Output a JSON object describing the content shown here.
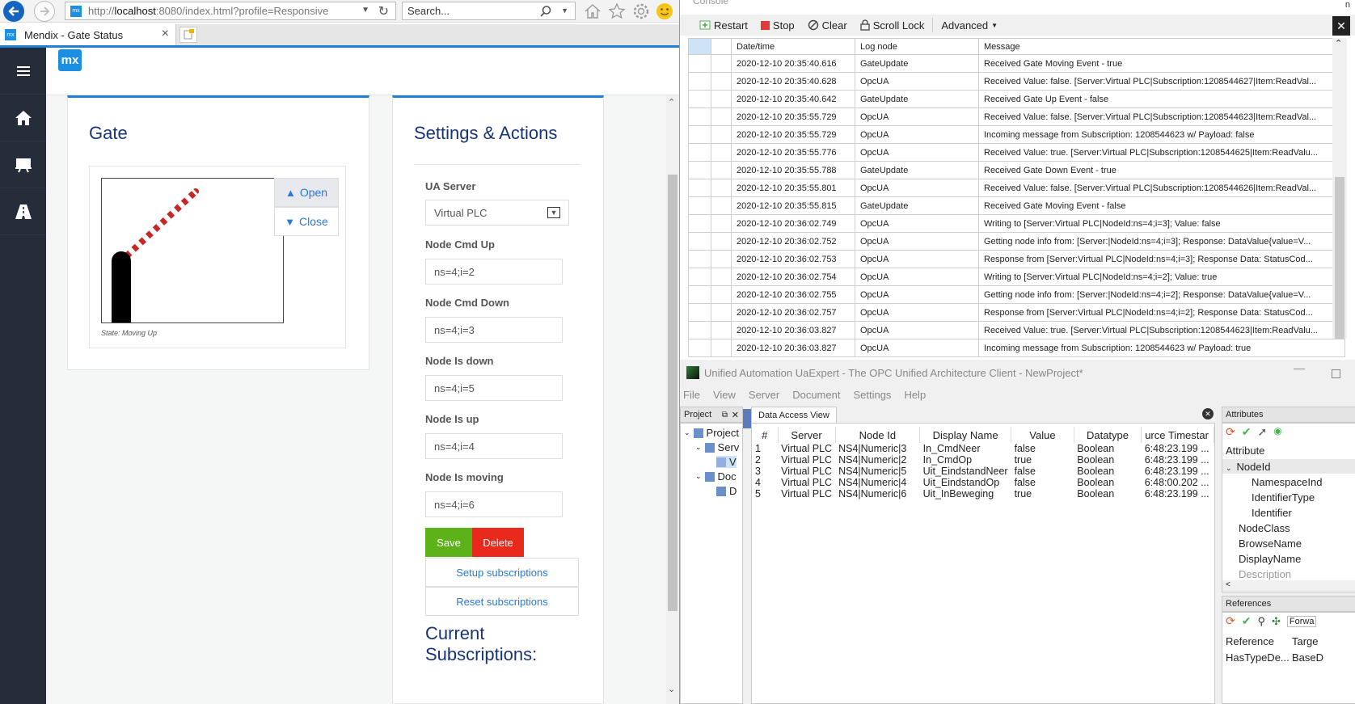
{
  "browser": {
    "url_prefix": "http://",
    "url_host": "localhost",
    "url_rest": ":8080/index.html?profile=Responsive",
    "search_placeholder": "Search...",
    "tab_title": "Mendix - Gate Status"
  },
  "mendix": {
    "logo": "mx",
    "gate_card": {
      "title": "Gate",
      "open_label": "Open",
      "close_label": "Close",
      "state_text": "State: Moving Up"
    },
    "settings_card": {
      "title": "Settings & Actions",
      "ua_server_label": "UA Server",
      "ua_server_value": "Virtual PLC",
      "fields": [
        {
          "label": "Node Cmd Up",
          "value": "ns=4;i=2"
        },
        {
          "label": "Node Cmd Down",
          "value": "ns=4;i=3"
        },
        {
          "label": "Node Is down",
          "value": "ns=4;i=5"
        },
        {
          "label": "Node Is up",
          "value": "ns=4;i=4"
        },
        {
          "label": "Node Is moving",
          "value": "ns=4;i=6"
        }
      ],
      "save_label": "Save",
      "delete_label": "Delete",
      "setup_label": "Setup subscriptions",
      "reset_label": "Reset subscriptions",
      "current_title_1": "Current",
      "current_title_2": "Subscriptions:"
    },
    "colors": {
      "sidebar": "#252c3a",
      "accent": "#1f7fd1",
      "save": "#5cb218",
      "delete": "#e8291c"
    }
  },
  "console": {
    "title": "Console",
    "toolbar": {
      "restart": "Restart",
      "stop": "Stop",
      "clear": "Clear",
      "scroll_lock": "Scroll Lock",
      "advanced": "Advanced"
    },
    "columns": [
      "Date/time",
      "Log node",
      "Message"
    ],
    "rows": [
      [
        "2020-12-10 20:35:40.616",
        "GateUpdate",
        "Received Gate Moving Event - true"
      ],
      [
        "2020-12-10 20:35:40.628",
        "OpcUA",
        "Received Value: false. [Server:Virtual PLC|Subscription:1208544627|Item:ReadVal..."
      ],
      [
        "2020-12-10 20:35:40.642",
        "GateUpdate",
        "Received Gate Up Event - false"
      ],
      [
        "2020-12-10 20:35:55.729",
        "OpcUA",
        "Received Value: false. [Server:Virtual PLC|Subscription:1208544623|Item:ReadVal..."
      ],
      [
        "2020-12-10 20:35:55.729",
        "OpcUA",
        "Incoming message from Subscription: 1208544623 w/ Payload: false"
      ],
      [
        "2020-12-10 20:35:55.776",
        "OpcUA",
        "Received Value: true. [Server:Virtual PLC|Subscription:1208544625|Item:ReadValu..."
      ],
      [
        "2020-12-10 20:35:55.788",
        "GateUpdate",
        "Received Gate Down Event - true"
      ],
      [
        "2020-12-10 20:35:55.801",
        "OpcUA",
        "Received Value: false. [Server:Virtual PLC|Subscription:1208544626|Item:ReadVal..."
      ],
      [
        "2020-12-10 20:35:55.815",
        "GateUpdate",
        "Received Gate Moving Event - false"
      ],
      [
        "2020-12-10 20:36:02.749",
        "OpcUA",
        "Writing to [Server:Virtual PLC|NodeId:ns=4;i=3]; Value: false"
      ],
      [
        "2020-12-10 20:36:02.752",
        "OpcUA",
        "Getting node info from: [Server:|NodeId:ns=4;i=3]; Response: DataValue{value=V..."
      ],
      [
        "2020-12-10 20:36:02.753",
        "OpcUA",
        "Response from [Server:Virtual PLC|NodeId:ns=4;i=3]; Response Data: StatusCod..."
      ],
      [
        "2020-12-10 20:36:02.754",
        "OpcUA",
        "Writing to [Server:Virtual PLC|NodeId:ns=4;i=2]; Value: true"
      ],
      [
        "2020-12-10 20:36:02.755",
        "OpcUA",
        "Getting node info from: [Server:|NodeId:ns=4;i=2]; Response: DataValue{value=V..."
      ],
      [
        "2020-12-10 20:36:02.757",
        "OpcUA",
        "Response from [Server:Virtual PLC|NodeId:ns=4;i=2]; Response Data: StatusCod..."
      ],
      [
        "2020-12-10 20:36:03.827",
        "OpcUA",
        "Received Value: true. [Server:Virtual PLC|Subscription:1208544623|Item:ReadValu..."
      ],
      [
        "2020-12-10 20:36:03.827",
        "OpcUA",
        "Incoming message from Subscription: 1208544623 w/ Payload: true"
      ]
    ]
  },
  "uaexpert": {
    "title": "Unified Automation UaExpert - The OPC Unified Architecture Client - NewProject*",
    "menu": [
      "File",
      "View",
      "Server",
      "Document",
      "Settings",
      "Help"
    ],
    "project_panel": {
      "title": "Project",
      "tree": [
        "Project",
        "Serv",
        "V",
        "Doc",
        "D"
      ]
    },
    "dav": {
      "tab": "Data Access View",
      "columns": [
        "#",
        "Server",
        "Node Id",
        "Display Name",
        "Value",
        "Datatype",
        "urce Timestar"
      ],
      "rows": [
        [
          "1",
          "Virtual PLC",
          "NS4|Numeric|3",
          "In_CmdNeer",
          "false",
          "Boolean",
          "6:48:23.199 ..."
        ],
        [
          "2",
          "Virtual PLC",
          "NS4|Numeric|2",
          "In_CmdOp",
          "true",
          "Boolean",
          "6:48:23.199 ..."
        ],
        [
          "3",
          "Virtual PLC",
          "NS4|Numeric|5",
          "Uit_EindstandNeer",
          "false",
          "Boolean",
          "6:48:23.199 ..."
        ],
        [
          "4",
          "Virtual PLC",
          "NS4|Numeric|4",
          "Uit_EindstandOp",
          "false",
          "Boolean",
          "6:48:00.202 ..."
        ],
        [
          "5",
          "Virtual PLC",
          "NS4|Numeric|6",
          "Uit_InBeweging",
          "true",
          "Boolean",
          "6:48:23.199 ..."
        ]
      ]
    },
    "attributes": {
      "title": "Attributes",
      "header": "Attribute",
      "rows": [
        "NodeId",
        "NamespaceInd",
        "IdentifierType",
        "Identifier",
        "NodeClass",
        "BrowseName",
        "DisplayName",
        "Description"
      ]
    },
    "references": {
      "title": "References",
      "forward": "Forwa",
      "col_reference": "Reference",
      "col_target": "Targe",
      "row_reference": "HasTypeDe...",
      "row_target": "BaseD"
    }
  }
}
